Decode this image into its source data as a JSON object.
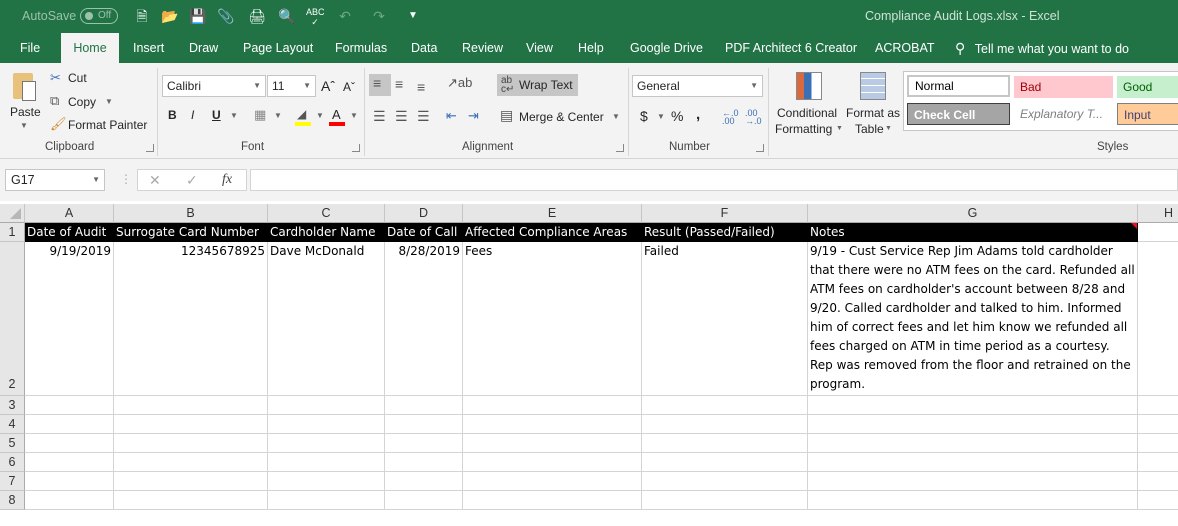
{
  "titlebar": {
    "autosave_label": "AutoSave",
    "autosave_state": "Off",
    "document_title": "Compliance Audit Logs.xlsx  -  Excel",
    "quick_access": [
      "new-file",
      "open-folder",
      "save",
      "attach",
      "print-manager",
      "print-preview",
      "spelling",
      "undo",
      "redo",
      "customize"
    ]
  },
  "tabs": [
    "File",
    "Home",
    "Insert",
    "Draw",
    "Page Layout",
    "Formulas",
    "Data",
    "Review",
    "View",
    "Help",
    "Google Drive",
    "PDF Architect 6 Creator",
    "ACROBAT"
  ],
  "active_tab": "Home",
  "tell_me": "Tell me what you want to do",
  "ribbon": {
    "clipboard": {
      "label": "Clipboard",
      "paste": "Paste",
      "cut": "Cut",
      "copy": "Copy",
      "format_painter": "Format Painter"
    },
    "font": {
      "label": "Font",
      "font_name": "Calibri",
      "font_size": "11",
      "bold": "B",
      "italic": "I",
      "underline": "U",
      "fill_color": "#ffff00",
      "font_color": "#ff0000"
    },
    "alignment": {
      "label": "Alignment",
      "wrap_text": "Wrap Text",
      "merge_center": "Merge & Center"
    },
    "number": {
      "label": "Number",
      "format": "General",
      "currency": "$",
      "percent": "%",
      "comma": ","
    },
    "styles": {
      "label": "Styles",
      "conditional_formatting": [
        "Conditional",
        "Formatting"
      ],
      "format_as_table": [
        "Format as",
        "Table"
      ],
      "cells": [
        {
          "name": "Normal",
          "bg": "#ffffff",
          "fg": "#000000"
        },
        {
          "name": "Bad",
          "bg": "#ffc7ce",
          "fg": "#9c0006"
        },
        {
          "name": "Good",
          "bg": "#c6efce",
          "fg": "#006100"
        },
        {
          "name": "Check Cell",
          "bg": "#a5a5a5",
          "fg": "#ffffff"
        },
        {
          "name": "Explanatory T...",
          "bg": "#ffffff",
          "fg": "#7f7f7f"
        },
        {
          "name": "Input",
          "bg": "#ffcc99",
          "fg": "#3f3f76"
        }
      ]
    }
  },
  "formula_bar": {
    "name_box": "G17",
    "cancel": "✕",
    "enter": "✓",
    "fx": "fx",
    "value": ""
  },
  "sheet": {
    "columns": [
      "A",
      "B",
      "C",
      "D",
      "E",
      "F",
      "G",
      "H"
    ],
    "rows": [
      "1",
      "2",
      "3",
      "4",
      "5",
      "6",
      "7",
      "8"
    ],
    "header_row": [
      "Date of Audit",
      "Surrogate Card Number",
      "Cardholder Name",
      "Date of Call",
      "Affected Compliance Areas",
      "Result (Passed/Failed)",
      "Notes",
      ""
    ],
    "data_rows": [
      [
        "9/19/2019",
        "12345678925",
        "Dave McDonald",
        "8/28/2019",
        "Fees",
        "Failed",
        "9/19 - Cust Service Rep Jim Adams told cardholder that there were no ATM fees on the card.  Refunded all ATM fees on cardholder's account between 8/28 and 9/20.  Called cardholder and talked to him.  Informed him of correct fees and let him know we refunded all fees charged on ATM in time period as a courtesy.  Rep was removed from the floor and retrained on the program.",
        ""
      ]
    ]
  }
}
